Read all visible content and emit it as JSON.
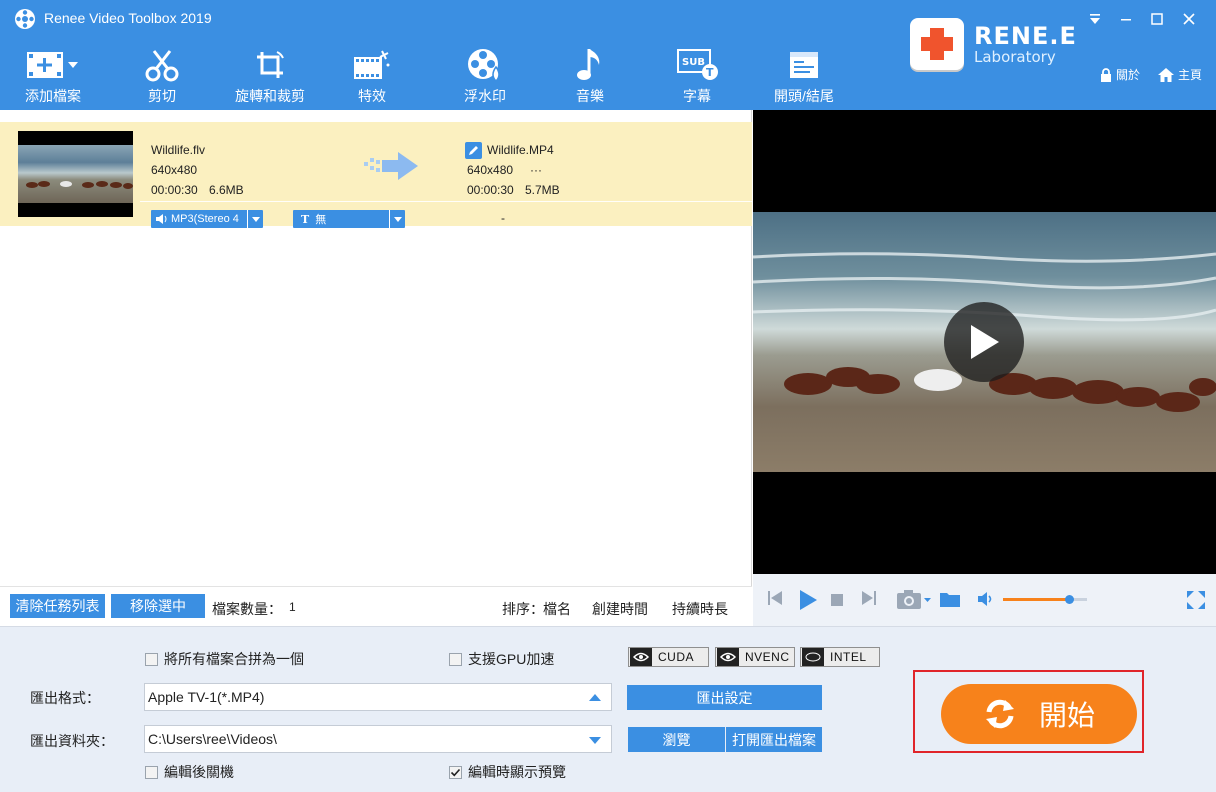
{
  "app": {
    "title": "Renee Video Toolbox 2019"
  },
  "toolbar": [
    {
      "label": "添加檔案",
      "icon": "add-file-icon"
    },
    {
      "label": "剪切",
      "icon": "scissors-icon"
    },
    {
      "label": "旋轉和裁剪",
      "icon": "rotate-crop-icon"
    },
    {
      "label": "特效",
      "icon": "effects-icon"
    },
    {
      "label": "浮水印",
      "icon": "watermark-icon"
    },
    {
      "label": "音樂",
      "icon": "music-note-icon"
    },
    {
      "label": "字幕",
      "icon": "subtitle-icon"
    },
    {
      "label": "開頭/結尾",
      "icon": "intro-outro-icon"
    }
  ],
  "brand": {
    "name": "RENE.E",
    "sub": "Laboratory"
  },
  "header_links": {
    "about": "關於",
    "home": "主頁"
  },
  "file": {
    "source_name": "Wildlife.flv",
    "source_res": "640x480",
    "source_duration": "00:00:30",
    "source_size": "6.6MB",
    "output_name": "Wildlife.MP4",
    "output_res": "640x480",
    "output_more": "···",
    "output_duration": "00:00:30",
    "output_size": "5.7MB",
    "audio_track": "MP3(Stereo 4",
    "subtitle_track": "無",
    "subtitle_value": "-"
  },
  "list_bar": {
    "clear_btn": "清除任務列表",
    "remove_btn": "移除選中",
    "count_label": "檔案數量：",
    "count_value": "1",
    "sort_label": "排序：",
    "sort_name": "檔名",
    "sort_created": "創建時間",
    "sort_duration": "持續時長"
  },
  "settings": {
    "merge_label": "將所有檔案合拼為一個",
    "merge_checked": false,
    "gpu_label": "支援GPU加速",
    "gpu_checked": false,
    "gpu_badges": [
      "CUDA",
      "NVENC",
      "INTEL"
    ],
    "format_label": "匯出格式：",
    "format_value": "Apple TV-1(*.MP4)",
    "export_settings_btn": "匯出設定",
    "folder_label": "匯出資料夾：",
    "folder_value": "C:\\Users\\ree\\Videos\\",
    "browse_btn": "瀏覽",
    "open_folder_btn": "打開匯出檔案",
    "shutdown_label": "編輯後關機",
    "shutdown_checked": false,
    "preview_label": "編輯時顯示預覽",
    "preview_checked": true,
    "start_btn": "開始"
  },
  "player": {
    "volume": 0.78
  },
  "colors": {
    "accent": "#3b8fe2",
    "highlight_row": "#fbf0c0",
    "start": "#f7821b",
    "frame": "#e0242a"
  }
}
